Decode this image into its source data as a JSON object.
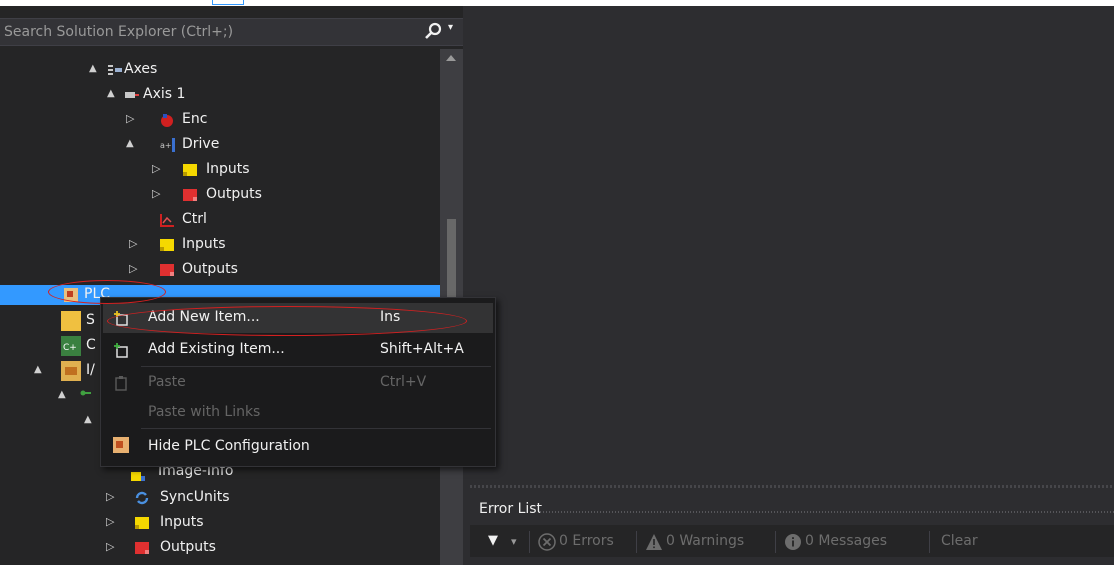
{
  "search": {
    "placeholder": "Search Solution Explorer (Ctrl+;)",
    "dropdown_glyph": "▾"
  },
  "tree": [
    {
      "label": "Axes",
      "icon": "axes-icon",
      "expander": "▲"
    },
    {
      "label": "Axis 1",
      "icon": "axis-icon",
      "expander": "▲"
    },
    {
      "label": "Enc",
      "icon": "encoder-icon",
      "expander": "▷"
    },
    {
      "label": "Drive",
      "icon": "drive-icon",
      "expander": "▲"
    },
    {
      "label": "Inputs",
      "icon": "inputs-icon",
      "expander": "▷"
    },
    {
      "label": "Outputs",
      "icon": "outputs-icon",
      "expander": "▷"
    },
    {
      "label": "Ctrl",
      "icon": "ctrl-icon",
      "expander": ""
    },
    {
      "label": "Inputs",
      "icon": "inputs-icon",
      "expander": "▷"
    },
    {
      "label": "Outputs",
      "icon": "outputs-icon",
      "expander": "▷"
    },
    {
      "label": "PLC",
      "icon": "plc-icon",
      "expander": "",
      "selected": true
    },
    {
      "label": "S",
      "icon": "safety-icon",
      "expander": ""
    },
    {
      "label": "C",
      "icon": "cpp-icon",
      "expander": ""
    },
    {
      "label": "I/",
      "icon": "io-icon",
      "expander": "▲"
    },
    {
      "label": "",
      "icon": "devices-icon",
      "expander": "▲"
    },
    {
      "label": "",
      "icon": "",
      "expander": "▲"
    },
    {
      "label": "Image-Info",
      "icon": "image-info-icon",
      "expander": ""
    },
    {
      "label": "SyncUnits",
      "icon": "syncunits-icon",
      "expander": "▷"
    },
    {
      "label": "Inputs",
      "icon": "inputs-icon",
      "expander": "▷"
    },
    {
      "label": "Outputs",
      "icon": "outputs-icon",
      "expander": "▷"
    }
  ],
  "context_menu": [
    {
      "label": "Add New Item...",
      "shortcut": "Ins",
      "icon": "add-new-item-icon",
      "enabled": true,
      "highlighted": true
    },
    {
      "label": "Add Existing Item...",
      "shortcut": "Shift+Alt+A",
      "icon": "add-existing-item-icon",
      "enabled": true
    },
    {
      "label": "Paste",
      "shortcut": "Ctrl+V",
      "icon": "paste-icon",
      "enabled": false
    },
    {
      "label": "Paste with Links",
      "shortcut": "",
      "icon": "",
      "enabled": false
    },
    {
      "label": "Hide PLC Configuration",
      "shortcut": "",
      "icon": "plc-config-icon",
      "enabled": true
    }
  ],
  "error_list": {
    "title": "Error List",
    "filter_glyph": "▼",
    "filter_dropdown_glyph": "▾",
    "errors": "0 Errors",
    "warnings": "0 Warnings",
    "messages": "0 Messages",
    "clear": "Clear"
  },
  "colors": {
    "selection": "#3399ff",
    "panel_background": "#252526",
    "annotation": "#d42020",
    "inputs_icon": "#f5d800",
    "outputs_icon": "#e03030"
  }
}
